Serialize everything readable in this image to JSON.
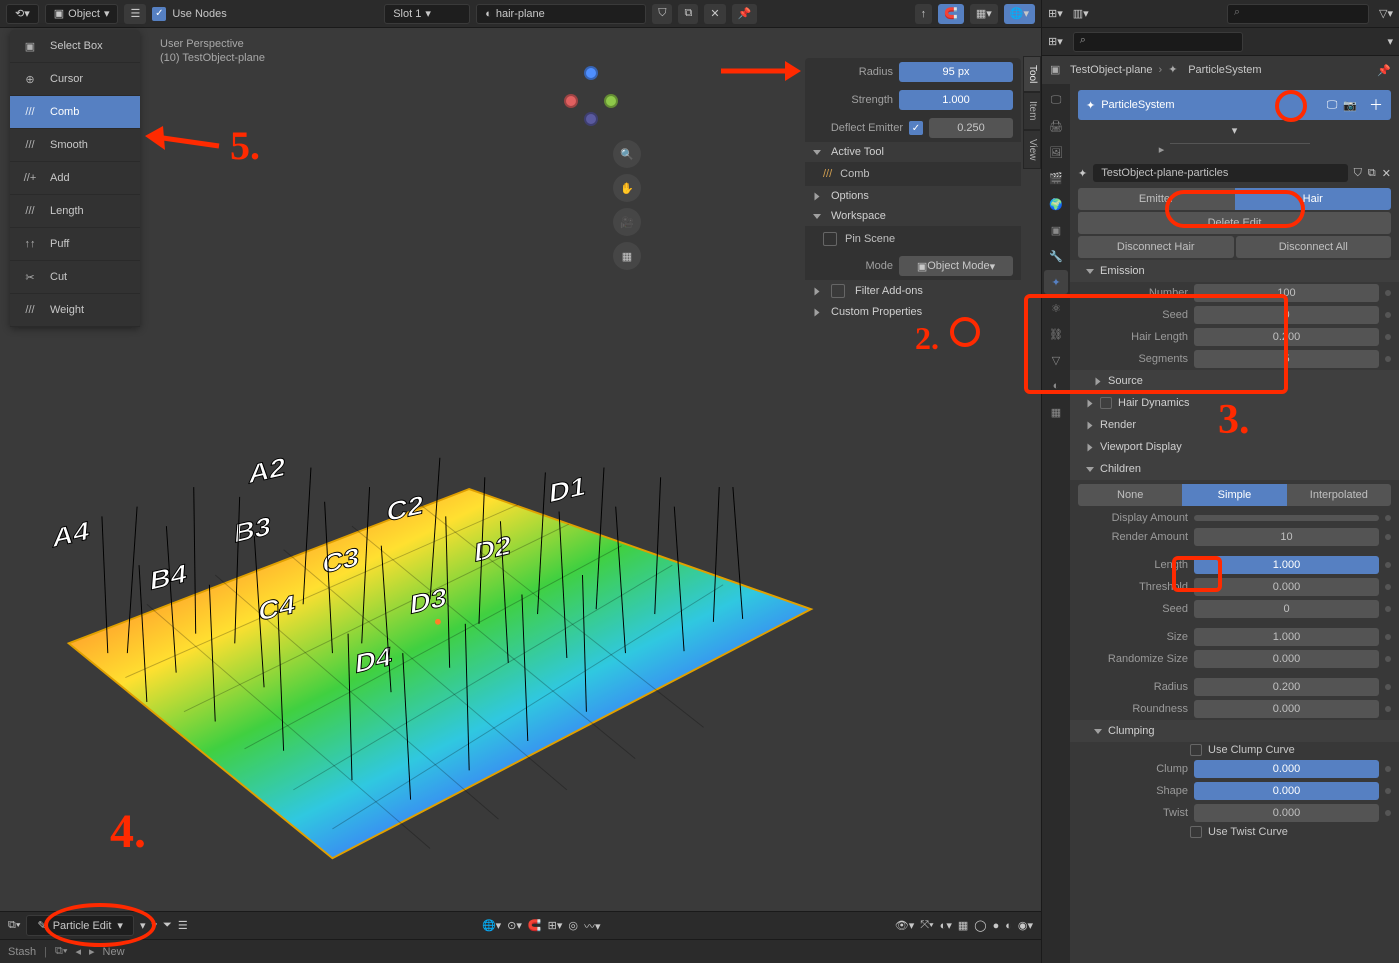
{
  "header": {
    "object_menu": "Object",
    "use_nodes_label": "Use Nodes",
    "slot": "Slot 1",
    "material": "hair-plane"
  },
  "toolbar": {
    "items": [
      {
        "label": "Select Box",
        "icon": "select-box"
      },
      {
        "label": "Cursor",
        "icon": "cursor"
      },
      {
        "label": "Comb",
        "icon": "comb",
        "selected": true
      },
      {
        "label": "Smooth",
        "icon": "smooth"
      },
      {
        "label": "Add",
        "icon": "add"
      },
      {
        "label": "Length",
        "icon": "length"
      },
      {
        "label": "Puff",
        "icon": "puff"
      },
      {
        "label": "Cut",
        "icon": "cut"
      },
      {
        "label": "Weight",
        "icon": "weight"
      }
    ]
  },
  "viewport": {
    "persp_line1": "User Perspective",
    "persp_line2": "(10) TestObject-plane"
  },
  "npanel": {
    "radius": {
      "label": "Radius",
      "value": "95 px"
    },
    "strength": {
      "label": "Strength",
      "value": "1.000"
    },
    "deflect": {
      "label": "Deflect Emitter",
      "value": "0.250"
    },
    "active_tool_header": "Active Tool",
    "active_tool_name": "Comb",
    "options_header": "Options",
    "workspace_header": "Workspace",
    "pin_scene": "Pin Scene",
    "mode_label": "Mode",
    "mode_value": "Object Mode",
    "filter_addons": "Filter Add-ons",
    "custom_props": "Custom Properties"
  },
  "vtabs": [
    "Tool",
    "Item",
    "View"
  ],
  "bottom": {
    "mode": "Particle Edit",
    "stash": "Stash",
    "new": "New"
  },
  "breadcrumb": {
    "obj": "TestObject-plane",
    "sys": "ParticleSystem"
  },
  "particle": {
    "name": "ParticleSystem",
    "settings_name": "TestObject-plane-particles",
    "type_emitter": "Emitter",
    "type_hair": "Hair",
    "delete_edit": "Delete Edit",
    "disconnect_hair": "Disconnect Hair",
    "disconnect_all": "Disconnect All",
    "emission_header": "Emission",
    "emission": {
      "number": {
        "label": "Number",
        "value": "100"
      },
      "seed": {
        "label": "Seed",
        "value": "0"
      },
      "hair_length": {
        "label": "Hair Length",
        "value": "0.200"
      },
      "segments": {
        "label": "Segments",
        "value": "5"
      }
    },
    "source_header": "Source",
    "hair_dynamics_header": "Hair Dynamics",
    "render_header": "Render",
    "viewport_display_header": "Viewport Display",
    "children_header": "Children",
    "children_type": {
      "none": "None",
      "simple": "Simple",
      "interpolated": "Interpolated"
    },
    "display_amount": {
      "label": "Display Amount",
      "value": ""
    },
    "render_amount": {
      "label": "Render Amount",
      "value": "10"
    },
    "length": {
      "label": "Length",
      "value": "1.000"
    },
    "threshold": {
      "label": "Threshold",
      "value": "0.000"
    },
    "cseed": {
      "label": "Seed",
      "value": "0"
    },
    "size": {
      "label": "Size",
      "value": "1.000"
    },
    "randomize_size": {
      "label": "Randomize Size",
      "value": "0.000"
    },
    "radius": {
      "label": "Radius",
      "value": "0.200"
    },
    "roundness": {
      "label": "Roundness",
      "value": "0.000"
    },
    "clumping_header": "Clumping",
    "use_clump_curve": "Use Clump Curve",
    "clump": {
      "label": "Clump",
      "value": "0.000"
    },
    "shape": {
      "label": "Shape",
      "value": "0.000"
    },
    "twist": {
      "label": "Twist",
      "value": "0.000"
    },
    "use_twist_curve": "Use Twist Curve"
  },
  "annotations": {
    "n2": "2.",
    "n3": "3.",
    "n4": "4.",
    "n5": "5."
  }
}
